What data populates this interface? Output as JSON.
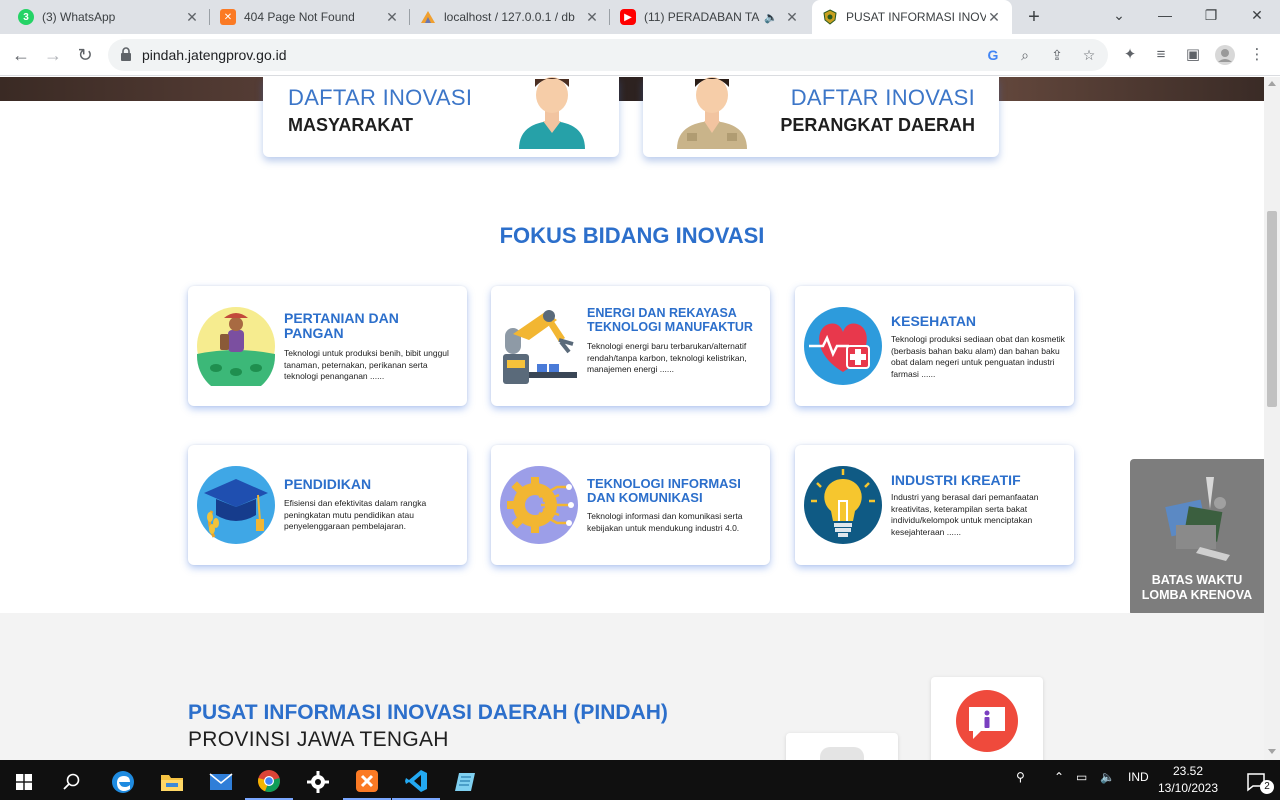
{
  "browser": {
    "tabs": [
      {
        "title": "(3) WhatsApp",
        "icon": "whatsapp-icon"
      },
      {
        "title": "404 Page Not Found",
        "icon": "xampp-icon"
      },
      {
        "title": "localhost / 127.0.0.1 / db",
        "icon": "phpmyadmin-icon"
      },
      {
        "title": "(11) PERADABAN TA",
        "icon": "youtube-icon"
      },
      {
        "title": "PUSAT INFORMASI INOV",
        "icon": "jateng-logo-icon"
      }
    ],
    "url": "pindah.jatengprov.go.id"
  },
  "page": {
    "daftar": [
      {
        "title": "DAFTAR INOVASI",
        "subtitle": "MASYARAKAT"
      },
      {
        "title": "DAFTAR INOVASI",
        "subtitle": "PERANGKAT DAERAH"
      }
    ],
    "section_title": "FOKUS BIDANG INOVASI",
    "cards": [
      {
        "title": "PERTANIAN DAN PANGAN",
        "desc": "Teknologi untuk produksi benih, bibit unggul tanaman, peternakan, perikanan serta teknologi penanganan ......"
      },
      {
        "title": "ENERGI DAN REKAYASA TEKNOLOGI MANUFAKTUR",
        "desc": "Teknologi energi baru terbarukan/alternatif rendah/tanpa karbon, teknologi kelistrikan, manajemen energi ......"
      },
      {
        "title": "KESEHATAN",
        "desc": "Teknologi produksi sediaan obat dan kosmetik (berbasis bahan baku alam) dan bahan baku obat dalam negeri untuk penguatan industri farmasi ......"
      },
      {
        "title": "PENDIDIKAN",
        "desc": "Efisiensi dan efektivitas dalam rangka peningkatan mutu pendidikan atau penyelenggaraan pembelajaran."
      },
      {
        "title": "TEKNOLOGI INFORMASI DAN KOMUNIKASI",
        "desc": "Teknologi informasi dan komunikasi serta kebijakan untuk mendukung industri 4.0."
      },
      {
        "title": "INDUSTRI KREATIF",
        "desc": "Industri yang berasal dari pemanfaatan kreativitas, keterampilan serta bakat individu/kelompok untuk menciptakan kesejahteraan ......"
      }
    ],
    "floating_button": "BATAS WAKTU LOMBA KRENOVA",
    "pindah_title": "PUSAT INFORMASI INOVASI DAERAH (PINDAH)",
    "pindah_subtitle": "PROVINSI JAWA TENGAH"
  },
  "taskbar": {
    "language": "IND",
    "time": "23.52",
    "date": "13/10/2023",
    "notifications": "2"
  },
  "colors": {
    "accent": "#2c6fcb",
    "tabbar": "#dee1e6",
    "taskbar": "#101010"
  }
}
